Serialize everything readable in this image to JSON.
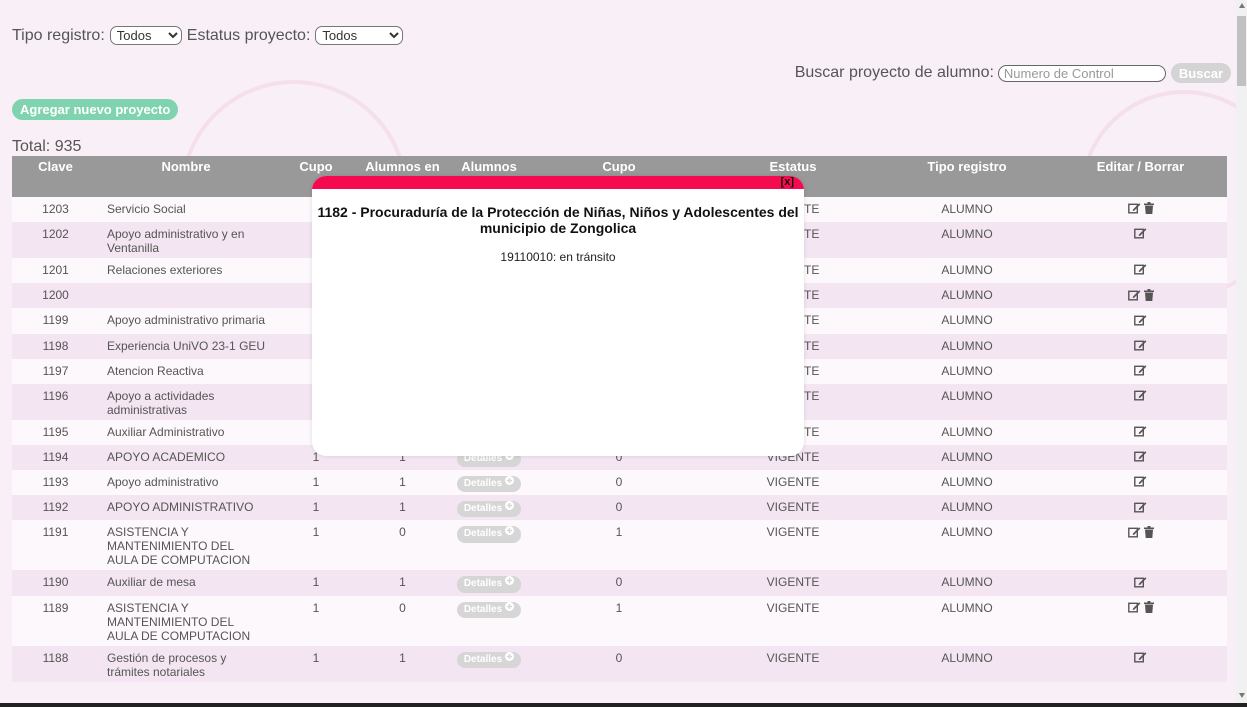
{
  "filters": {
    "tipo_registro_label": "Tipo registro:",
    "tipo_registro_value": "Todos",
    "estatus_label": "Estatus proyecto:",
    "estatus_value": "Todos"
  },
  "search": {
    "label": "Buscar proyecto de alumno:",
    "placeholder": "Numero de Control",
    "button": "Buscar"
  },
  "add_button": "Agregar nuevo proyecto",
  "total": "Total: 935",
  "table": {
    "headers": [
      "Clave",
      "Nombre",
      "Cupo",
      "Alumnos en",
      "Alumnos",
      "Cupo",
      "Estatus",
      "Tipo registro",
      "Editar / Borrar"
    ],
    "details_label": "Detalles",
    "rows": [
      {
        "clave": "1203",
        "nombre": "Servicio Social",
        "cupo": "",
        "alumnos_en": "",
        "cupo2": "",
        "estatus": "VIGENTE",
        "tipo": "ALUMNO",
        "delete": true
      },
      {
        "clave": "1202",
        "nombre": "Apoyo administrativo y en Ventanilla",
        "cupo": "",
        "alumnos_en": "",
        "cupo2": "",
        "estatus": "VIGENTE",
        "tipo": "ALUMNO",
        "delete": false
      },
      {
        "clave": "1201",
        "nombre": "Relaciones exteriores",
        "cupo": "",
        "alumnos_en": "",
        "cupo2": "",
        "estatus": "VIGENTE",
        "tipo": "ALUMNO",
        "delete": false
      },
      {
        "clave": "1200",
        "nombre": "",
        "cupo": "",
        "alumnos_en": "",
        "cupo2": "",
        "estatus": "VIGENTE",
        "tipo": "ALUMNO",
        "delete": true
      },
      {
        "clave": "1199",
        "nombre": "Apoyo administrativo primaria",
        "cupo": "",
        "alumnos_en": "",
        "cupo2": "",
        "estatus": "VIGENTE",
        "tipo": "ALUMNO",
        "delete": false
      },
      {
        "clave": "1198",
        "nombre": "Experiencia UniVO 23-1 GEU",
        "cupo": "",
        "alumnos_en": "",
        "cupo2": "",
        "estatus": "VIGENTE",
        "tipo": "ALUMNO",
        "delete": false
      },
      {
        "clave": "1197",
        "nombre": "Atencion Reactiva",
        "cupo": "",
        "alumnos_en": "",
        "cupo2": "",
        "estatus": "VIGENTE",
        "tipo": "ALUMNO",
        "delete": false
      },
      {
        "clave": "1196",
        "nombre": "Apoyo a actividades administrativas",
        "cupo": "",
        "alumnos_en": "",
        "cupo2": "",
        "estatus": "VIGENTE",
        "tipo": "ALUMNO",
        "delete": false
      },
      {
        "clave": "1195",
        "nombre": "Auxiliar Administrativo",
        "cupo": "",
        "alumnos_en": "",
        "cupo2": "",
        "estatus": "VIGENTE",
        "tipo": "ALUMNO",
        "delete": false
      },
      {
        "clave": "1194",
        "nombre": "APOYO ACADEMICO",
        "cupo": "1",
        "alumnos_en": "1",
        "cupo2": "0",
        "estatus": "VIGENTE",
        "tipo": "ALUMNO",
        "delete": false
      },
      {
        "clave": "1193",
        "nombre": "Apoyo administrativo",
        "cupo": "1",
        "alumnos_en": "1",
        "cupo2": "0",
        "estatus": "VIGENTE",
        "tipo": "ALUMNO",
        "delete": false
      },
      {
        "clave": "1192",
        "nombre": "APOYO ADMINISTRATIVO",
        "cupo": "1",
        "alumnos_en": "1",
        "cupo2": "0",
        "estatus": "VIGENTE",
        "tipo": "ALUMNO",
        "delete": false
      },
      {
        "clave": "1191",
        "nombre": "ASISTENCIA Y MANTENIMIENTO DEL AULA DE COMPUTACION",
        "cupo": "1",
        "alumnos_en": "0",
        "cupo2": "1",
        "estatus": "VIGENTE",
        "tipo": "ALUMNO",
        "delete": true
      },
      {
        "clave": "1190",
        "nombre": "Auxiliar de mesa",
        "cupo": "1",
        "alumnos_en": "1",
        "cupo2": "0",
        "estatus": "VIGENTE",
        "tipo": "ALUMNO",
        "delete": false
      },
      {
        "clave": "1189",
        "nombre": "ASISTENCIA Y MANTENIMIENTO DEL AULA DE COMPUTACION",
        "cupo": "1",
        "alumnos_en": "0",
        "cupo2": "1",
        "estatus": "VIGENTE",
        "tipo": "ALUMNO",
        "delete": true
      },
      {
        "clave": "1188",
        "nombre": "Gestión de procesos y trámites notariales",
        "cupo": "1",
        "alumnos_en": "1",
        "cupo2": "0",
        "estatus": "VIGENTE",
        "tipo": "ALUMNO",
        "delete": false
      }
    ]
  },
  "modal": {
    "close": "[x]",
    "title": "1182 - Procuraduría de la Protección de Niñas, Niños y Adolescentes del municipio de Zongolica",
    "line": "19110010: en tránsito"
  },
  "colors": {
    "page_bg": "#f9f0f7",
    "header_bg": "#999999",
    "modal_bar": "#f50a4f",
    "add_button": "#7fd3ae",
    "details_button": "#d6d6d6"
  }
}
